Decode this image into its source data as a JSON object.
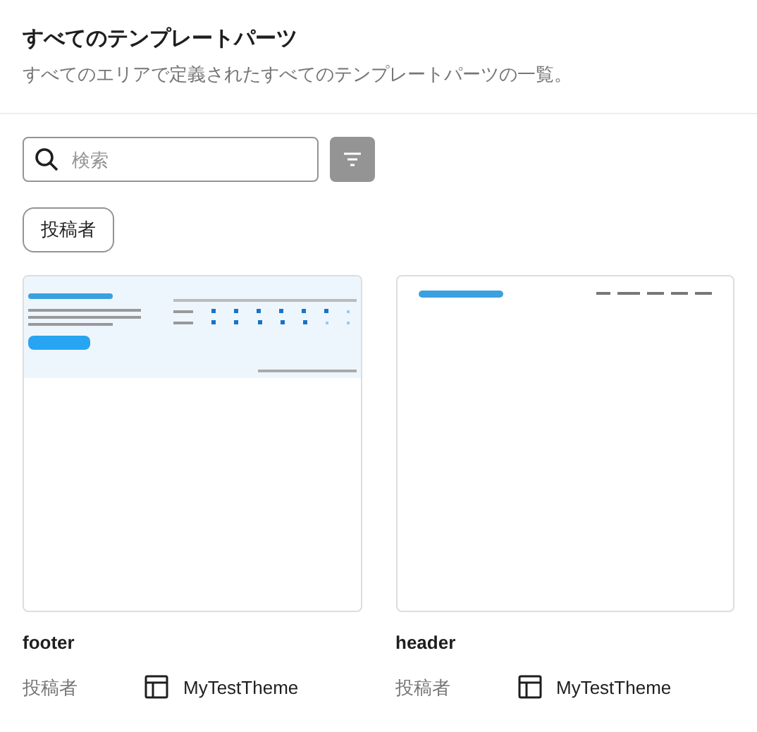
{
  "header": {
    "title": "すべてのテンプレートパーツ",
    "description": "すべてのエリアで定義されたすべてのテンプレートパーツの一覧。"
  },
  "search": {
    "placeholder": "検索"
  },
  "filters": [
    {
      "label": "投稿者"
    }
  ],
  "cards": [
    {
      "kind": "footer",
      "name": "footer",
      "meta_label": "投稿者",
      "source": "MyTestTheme"
    },
    {
      "kind": "header",
      "name": "header",
      "meta_label": "投稿者",
      "source": "MyTestTheme"
    }
  ]
}
